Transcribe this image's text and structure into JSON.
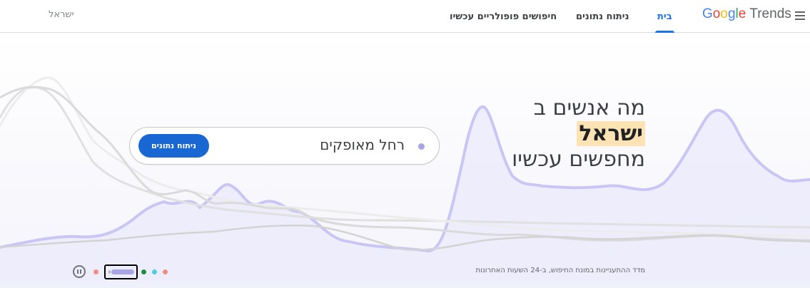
{
  "header": {
    "logo_google": "Google",
    "logo_trends": "Trends",
    "nav": [
      {
        "label": "בית",
        "active": true
      },
      {
        "label": "ניתוח נתונים",
        "active": false
      },
      {
        "label": "חיפושים פופולריים עכשיו",
        "active": false
      }
    ],
    "country": "ישראל"
  },
  "hero": {
    "headline_line1": "מה אנשים ב",
    "headline_highlight": "ישראל",
    "headline_line3": "מחפשים עכשיו",
    "search_query": "רחל מאופקים",
    "search_button": "ניתוח נתונים",
    "caption": "מדד ההתעניינות במונח החיפוש, ב-24 השעות האחרונות"
  },
  "carousel": {
    "dot_colors": [
      "#f28b82",
      "#a9a4e6",
      "#1e8e3e",
      "#4ecde6",
      "#f28b82"
    ],
    "active_index": 1
  },
  "colors": {
    "accent": "#1a73e8",
    "button": "#1967d2",
    "highlight": "#fde3b3",
    "trend_line": "#c9c6f5"
  }
}
